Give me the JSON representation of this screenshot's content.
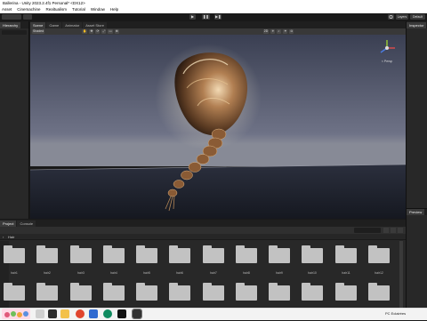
{
  "window": {
    "title": "Ballerina - Unity 2023.2.4f1 Personal* <DX12>"
  },
  "menu": {
    "items": [
      "Asset",
      "Cinemachine",
      "Realtualism",
      "Tutorial",
      "Window",
      "Help"
    ]
  },
  "toolbar": {
    "play": "▶",
    "pause": "❚❚",
    "step": "▶❚",
    "layers_label": "Layers",
    "layout_label": "Default"
  },
  "hierarchy": {
    "tab": "Hierarchy"
  },
  "scene": {
    "tabs": [
      "Scene",
      "Game",
      "Animator",
      "Asset Store"
    ],
    "shading_mode": "Shaded",
    "view_label": "2D",
    "gizmo_label": "< Persp"
  },
  "inspector": {
    "tab": "Inspector"
  },
  "preview": {
    "tab": "Preview"
  },
  "project": {
    "tabs": [
      "Project",
      "Console"
    ],
    "path": "Hair",
    "folders": [
      "hair1",
      "hair2",
      "hair3",
      "hair4",
      "hair5",
      "hair6",
      "hair7",
      "hair8",
      "hair9",
      "hair10",
      "hair11",
      "hair12"
    ]
  },
  "taskbar": {
    "tray_text": "PC  Eclairées",
    "weather": ""
  }
}
